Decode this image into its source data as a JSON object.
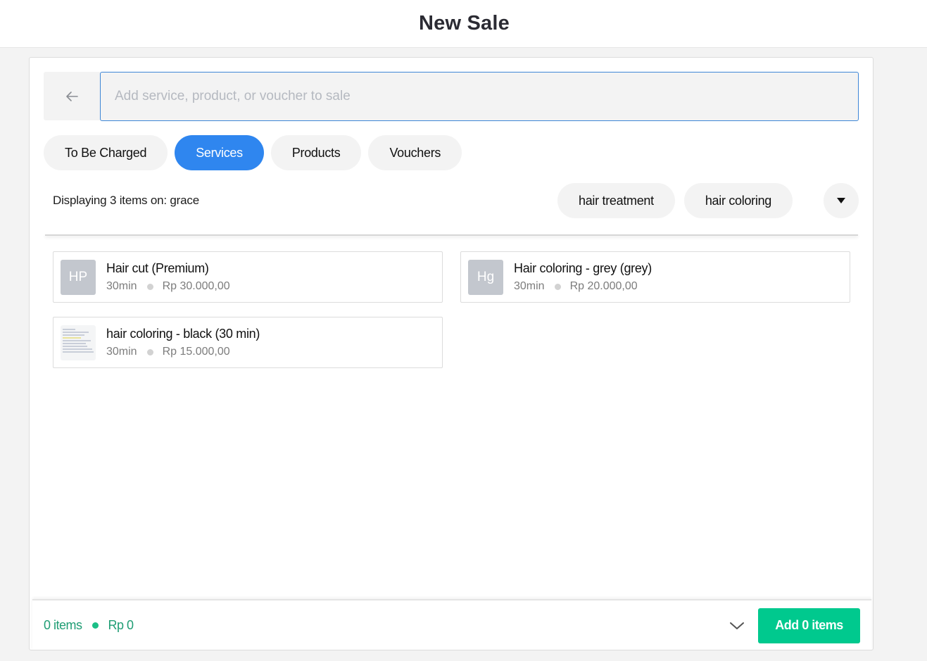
{
  "header": {
    "title": "New Sale"
  },
  "search": {
    "placeholder": "Add service, product, or voucher to sale",
    "value": ""
  },
  "tabs": [
    {
      "label": "To Be Charged",
      "active": false
    },
    {
      "label": "Services",
      "active": true
    },
    {
      "label": "Products",
      "active": false
    },
    {
      "label": "Vouchers",
      "active": false
    }
  ],
  "filter": {
    "displaying_text": "Displaying 3 items on: grace",
    "chips": [
      "hair treatment",
      "hair coloring"
    ],
    "more_icon": "caret-down-icon"
  },
  "items": [
    {
      "initials": "HP",
      "name": "Hair cut (Premium)",
      "duration": "30min",
      "price": "Rp 30.000,00",
      "thumbnail": false
    },
    {
      "initials": "Hg",
      "name": "Hair coloring - grey (grey)",
      "duration": "30min",
      "price": "Rp 20.000,00",
      "thumbnail": false
    },
    {
      "initials": "",
      "name": "hair coloring - black (30 min)",
      "duration": "30min",
      "price": "Rp 15.000,00",
      "thumbnail": true
    }
  ],
  "footer": {
    "items_count": "0 items",
    "total": "Rp 0",
    "add_button": "Add 0 items"
  },
  "colors": {
    "accent_blue": "#2f86ef",
    "accent_green": "#00c98e",
    "summary_green": "#1f9d74",
    "avatar_grey": "#c3c7ce"
  }
}
